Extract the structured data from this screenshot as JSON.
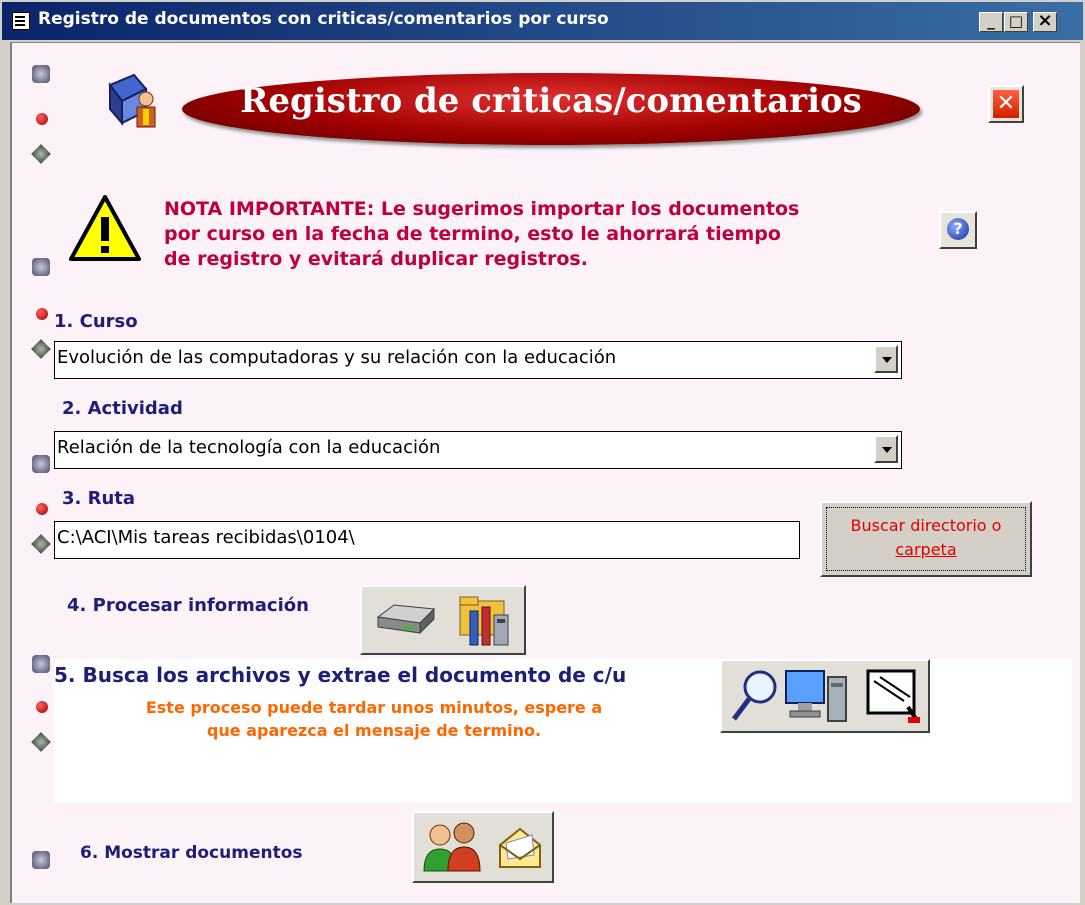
{
  "window": {
    "title": "Registro de documentos con criticas/comentarios por curso",
    "minimize_glyph": "_",
    "maximize_glyph": "□",
    "close_glyph": "×"
  },
  "header": {
    "banner_title": "Registro de criticas/comentarios",
    "banner_color": "#a00000",
    "close_glyph": "✕"
  },
  "note": {
    "text_line1": "NOTA IMPORTANTE: Le sugerimos importar los documentos",
    "text_line2": "por curso en la fecha de termino, esto le ahorrará tiempo",
    "text_line3": "de registro y evitará duplicar registros.",
    "color": "#c0003c",
    "help_glyph": "?"
  },
  "step1": {
    "label": "1. Curso",
    "value": "Evolución de las computadoras y su relación con la educación"
  },
  "step2": {
    "label": "2. Actividad",
    "value": "Relación de la tecnología con la educación"
  },
  "step3": {
    "label": "3. Ruta",
    "value": "C:\\ACI\\Mis tareas recibidas\\0104\\",
    "browse_line1": "Buscar directorio o",
    "browse_line2": "carpeta"
  },
  "step4": {
    "label": "4. Procesar información"
  },
  "step5": {
    "label": "5. Busca los archivos y extrae el documento de c/u",
    "warning_line1": "Este proceso puede tardar unos minutos, espere a",
    "warning_line2": "que aparezca el mensaje de termino.",
    "warning_color": "#ff6600"
  },
  "step6": {
    "label": "6. Mostrar documentos"
  },
  "icons": {
    "titlebar": "form-icon",
    "banner": "books-user-icon",
    "warning": "warning-icon",
    "help": "help-icon",
    "process": [
      "drive-icon",
      "folder-tools-icon"
    ],
    "search": [
      "magnifier-icon",
      "computer-icon",
      "document-pen-icon"
    ],
    "show": [
      "users-icon",
      "open-envelope-icon"
    ]
  }
}
